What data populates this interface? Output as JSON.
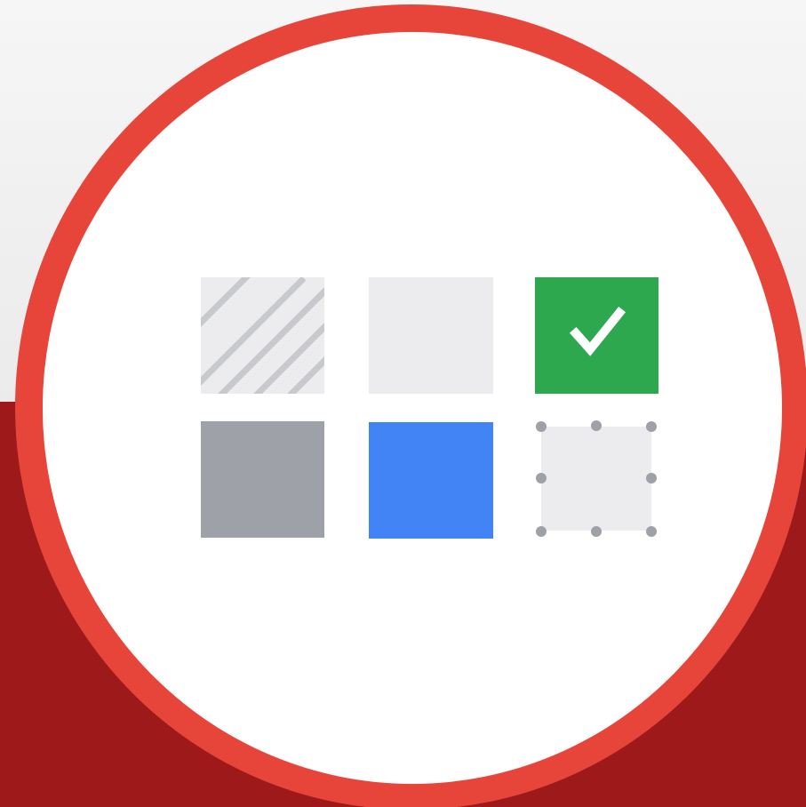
{
  "colors": {
    "background_light": "#efefef",
    "background_dark_red": "#9e1a1a",
    "ring_red": "#e8453a",
    "disc_white": "#ffffff",
    "tile_light_gray": "#ececee",
    "stripe_gray": "#c8c9cc",
    "tile_green": "#2ea84f",
    "tile_gray": "#9ea2a8",
    "tile_blue": "#4284f5",
    "handle_gray": "#9ea2a8",
    "check_white": "#ffffff"
  },
  "tiles": [
    {
      "name": "striped-tile",
      "style": "diagonal-stripes"
    },
    {
      "name": "empty-tile",
      "style": "plain-light"
    },
    {
      "name": "checked-tile",
      "style": "green-check",
      "icon": "check-icon"
    },
    {
      "name": "gray-tile",
      "style": "solid-gray"
    },
    {
      "name": "blue-tile",
      "style": "solid-blue"
    },
    {
      "name": "selected-tile",
      "style": "selection-handles"
    }
  ]
}
